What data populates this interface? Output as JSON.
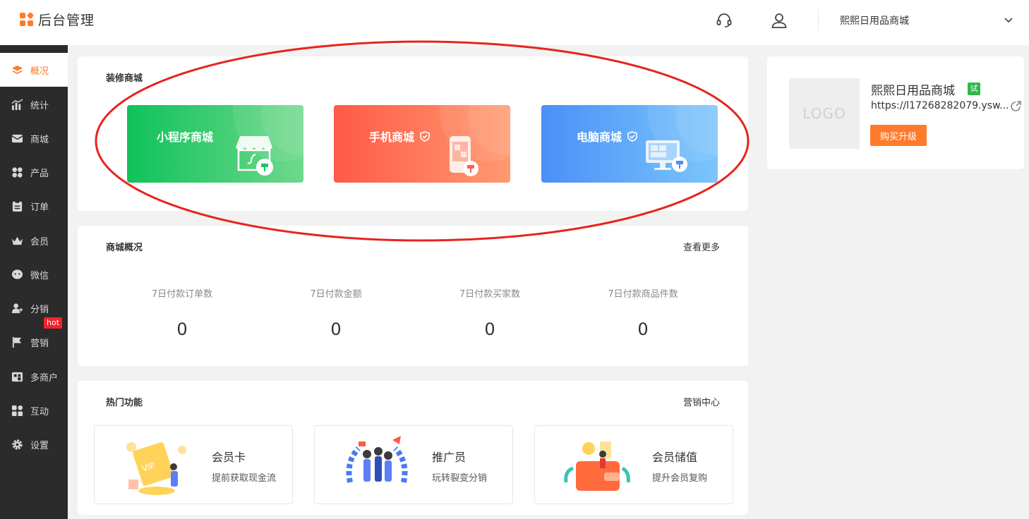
{
  "header": {
    "app_title": "后台管理",
    "shop_selector": "熙熙日用品商城",
    "icons": [
      "support-headset-icon",
      "user-icon",
      "chevron-down-icon"
    ]
  },
  "sidebar": {
    "items": [
      {
        "label": "概况",
        "icon": "layers-icon",
        "active": true
      },
      {
        "label": "统计",
        "icon": "chart-icon"
      },
      {
        "label": "商城",
        "icon": "mail-icon"
      },
      {
        "label": "产品",
        "icon": "grid-icon"
      },
      {
        "label": "订单",
        "icon": "clipboard-icon"
      },
      {
        "label": "会员",
        "icon": "crown-icon"
      },
      {
        "label": "微信",
        "icon": "wechat-icon"
      },
      {
        "label": "分销",
        "icon": "users-icon"
      },
      {
        "label": "营销",
        "icon": "flag-icon",
        "badge": "hot"
      },
      {
        "label": "多商户",
        "icon": "store-icon"
      },
      {
        "label": "互动",
        "icon": "apps-icon"
      },
      {
        "label": "设置",
        "icon": "gear-icon"
      }
    ]
  },
  "decorate": {
    "title": "装修商城",
    "tiles": [
      {
        "label": "小程序商城",
        "shield": false,
        "color_from": "#0fc25a",
        "color_to": "#6fd88c"
      },
      {
        "label": "手机商城",
        "shield": true,
        "color_from": "#ff5a45",
        "color_to": "#ff9a70"
      },
      {
        "label": "电脑商城",
        "shield": true,
        "color_from": "#4a90f8",
        "color_to": "#7cc6fb"
      }
    ]
  },
  "overview": {
    "title": "商城概况",
    "more_label": "查看更多",
    "stats": [
      {
        "label": "7日付款订单数",
        "value": "0"
      },
      {
        "label": "7日付款金额",
        "value": "0"
      },
      {
        "label": "7日付款买家数",
        "value": "0"
      },
      {
        "label": "7日付款商品件数",
        "value": "0"
      }
    ]
  },
  "hot_features": {
    "title": "热门功能",
    "more_label": "营销中心",
    "items": [
      {
        "name": "会员卡",
        "desc": "提前获取现金流"
      },
      {
        "name": "推广员",
        "desc": "玩转裂变分销"
      },
      {
        "name": "会员储值",
        "desc": "提升会员复购"
      }
    ]
  },
  "shop_card": {
    "logo_text": "LOGO",
    "name": "熙熙日用品商城",
    "trial_badge": "试",
    "url": "https://l17268282079.ysw...",
    "upgrade_label": "购买升级"
  },
  "colors": {
    "accent": "#ff7a2c",
    "sidebar_bg": "#2b2b2b",
    "annotation_red": "#e8231d",
    "hot_badge": "#f5222d"
  }
}
